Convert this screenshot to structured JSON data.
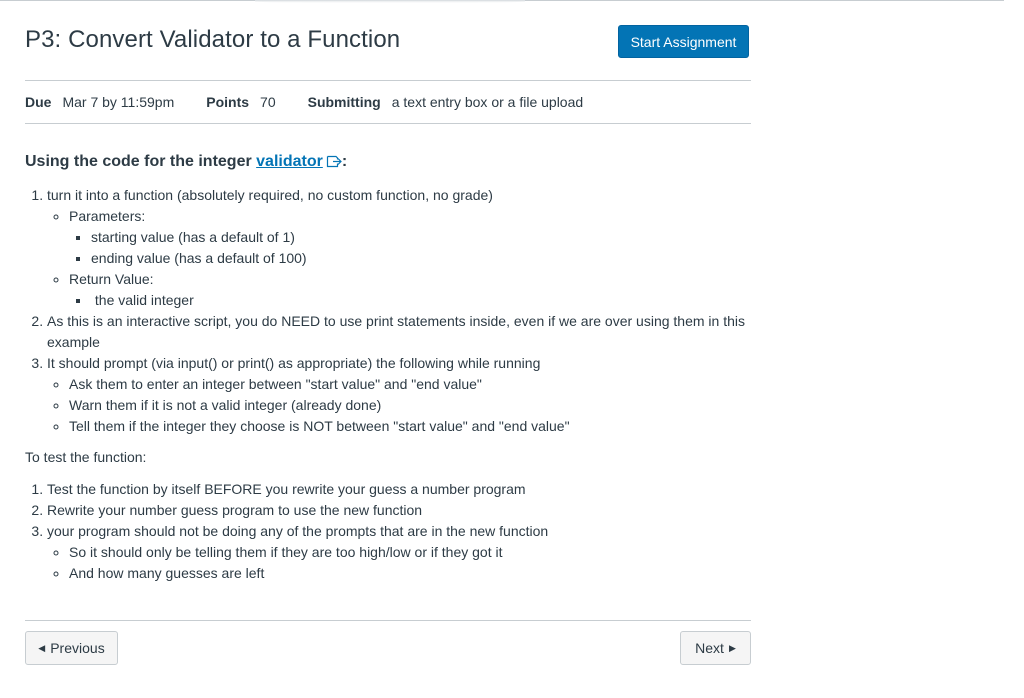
{
  "assignment": {
    "title": "P3: Convert Validator to a Function",
    "start_button": "Start Assignment"
  },
  "details": {
    "due_label": "Due",
    "due_value": "Mar 7 by 11:59pm",
    "points_label": "Points",
    "points_value": "70",
    "submitting_label": "Submitting",
    "submitting_value": "a text entry box or a file upload"
  },
  "content": {
    "heading_prefix": "Using the code for the  integer ",
    "heading_link": "validator",
    "heading_suffix": ":",
    "list1": [
      {
        "text": "turn it into a function (absolutely required, no  custom function, no grade)",
        "sub": [
          {
            "text": "Parameters:",
            "sub": [
              "starting value (has a default of 1)",
              "ending value (has a default of 100)"
            ]
          },
          {
            "text": "Return Value:",
            "sub": [
              " the valid integer"
            ]
          }
        ]
      },
      {
        "text": "As this is an interactive script, you do NEED to use print statements inside, even if we are over using them in this example"
      },
      {
        "text": "It should prompt (via input()  or print() as appropriate) the following while running",
        "sub": [
          "Ask them to enter an integer between  \"start value\"  and \"end value\"",
          "Warn them if it is not a valid integer (already done)",
          "Tell them if the integer they choose is NOT between \"start value\" and \"end value\""
        ]
      }
    ],
    "test_intro": "To test the function:",
    "list2": [
      {
        "text": "Test the function by itself BEFORE you rewrite your guess a number program"
      },
      {
        "text": " Rewrite your number guess program to use the new function"
      },
      {
        "text": "your program should not be doing any of the prompts that are in the new function",
        "sub": [
          "So it should only be telling them if they are too high/low or if they got it",
          "And how many guesses are left"
        ]
      }
    ]
  },
  "nav": {
    "previous": "Previous",
    "next": "Next"
  },
  "icons": {
    "external_link": "external-link-icon",
    "prev_arrow": "caret-left-icon",
    "next_arrow": "caret-right-icon"
  },
  "colors": {
    "primary": "#0374b5",
    "text": "#2d3b45",
    "border": "#c7cdd1"
  }
}
